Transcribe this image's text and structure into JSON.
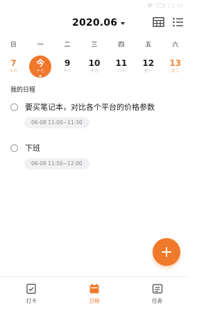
{
  "status_bar": {
    "time": "13:40"
  },
  "header": {
    "month": "2020.06"
  },
  "week": {
    "weekdays": [
      "日",
      "一",
      "二",
      "三",
      "四",
      "五",
      "六"
    ],
    "days": [
      {
        "num": "7",
        "lunar": "十六",
        "weekend": true,
        "today": false
      },
      {
        "num": "今",
        "lunar": "十七",
        "weekend": false,
        "today": true
      },
      {
        "num": "9",
        "lunar": "十八",
        "weekend": false,
        "today": false
      },
      {
        "num": "10",
        "lunar": "十九",
        "weekend": false,
        "today": false
      },
      {
        "num": "11",
        "lunar": "二十",
        "weekend": false,
        "today": false
      },
      {
        "num": "12",
        "lunar": "廿一",
        "weekend": false,
        "today": false
      },
      {
        "num": "13",
        "lunar": "廿二",
        "weekend": true,
        "today": false
      }
    ]
  },
  "schedule": {
    "title": "我的日程",
    "items": [
      {
        "title": "要买笔记本，对比各个平台的价格参数",
        "time": "06-08 11:00~11:30"
      },
      {
        "title": "下班",
        "time": "06-08 11:50~12:00"
      }
    ]
  },
  "tabs": [
    {
      "label": "打卡",
      "icon": "checkin-icon",
      "active": false
    },
    {
      "label": "日程",
      "icon": "calendar-icon",
      "active": true
    },
    {
      "label": "任务",
      "icon": "task-list-icon",
      "active": false
    }
  ],
  "colors": {
    "accent": "#f07a2c",
    "weekend": "#f08a3a",
    "chip_bg": "#f1f1f3"
  }
}
